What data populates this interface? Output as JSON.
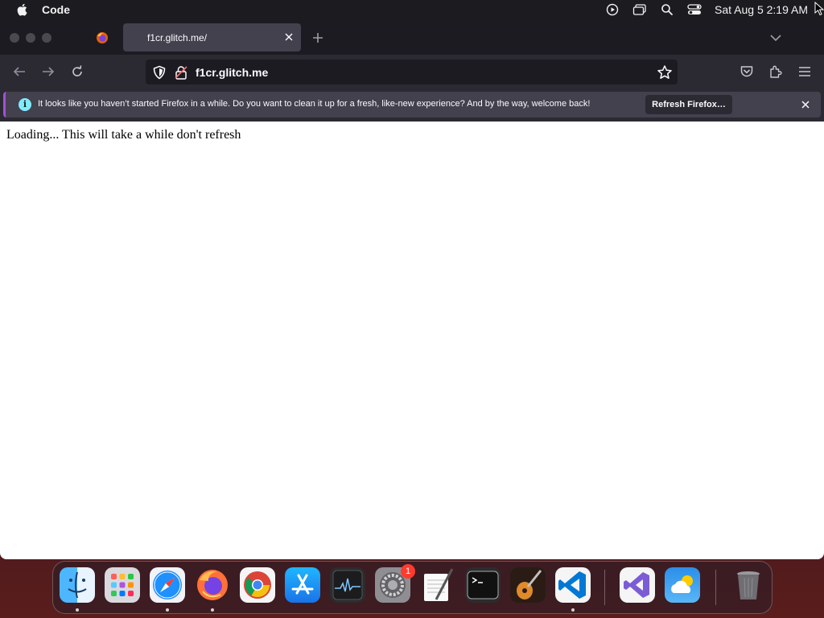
{
  "menubar": {
    "app_name": "Code",
    "clock": "Sat Aug 5  2:19 AM",
    "icons": [
      "play-circle-icon",
      "screen-mirroring-icon",
      "search-icon",
      "control-center-icon"
    ]
  },
  "browser": {
    "tab": {
      "title": "f1cr.glitch.me/"
    },
    "url": "f1cr.glitch.me",
    "notification": {
      "message": "It looks like you haven’t started Firefox in a while. Do you want to clean it up for a fresh, like-new experience? And by the way, welcome back!",
      "button_label": "Refresh Firefox…"
    },
    "page": {
      "body_text": "Loading... This will take a while don't refresh"
    }
  },
  "dock": {
    "apps": [
      "Finder",
      "Launchpad",
      "Safari",
      "Firefox",
      "Google Chrome",
      "App Store",
      "Activity Monitor",
      "System Settings",
      "TextEdit",
      "Terminal",
      "GarageBand",
      "Visual Studio Code",
      "Visual Studio",
      "Weather",
      "Trash"
    ],
    "system_settings_badge": "1"
  },
  "colors": {
    "accent": "#a44fd6",
    "info": "#80ebff",
    "toolbar": "#2b2a33",
    "tabbar": "#1c1b22"
  }
}
